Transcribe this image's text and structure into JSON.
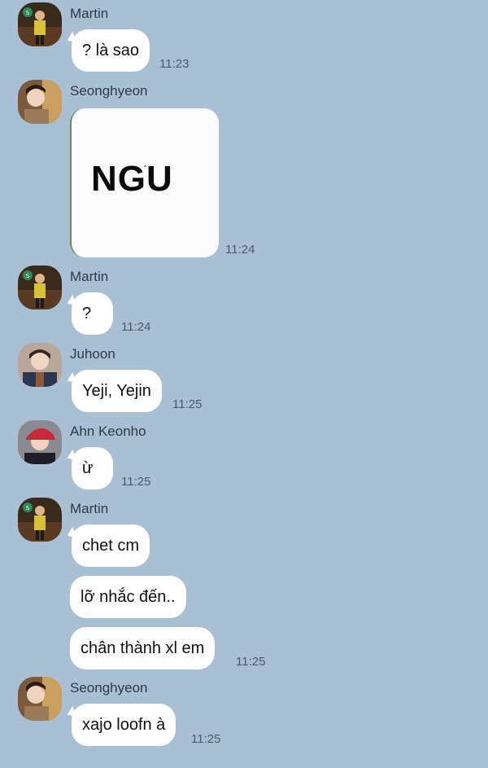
{
  "messages": [
    {
      "sender": "Martin",
      "text": "? là sao",
      "time": "11:23"
    },
    {
      "sender": "Seonghyeon",
      "sticker_text": "NGU",
      "sticker_accent": "ˆ",
      "time": "11:24"
    },
    {
      "sender": "Martin",
      "text": "?",
      "time": "11:24"
    },
    {
      "sender": "Juhoon",
      "text": "Yeji, Yejin",
      "time": "11:25"
    },
    {
      "sender": "Ahn Keonho",
      "text": "ừ",
      "time": "11:25"
    },
    {
      "sender": "Martin",
      "texts": [
        "chet cm",
        "lỡ nhắc đến..",
        "chân thành xl em"
      ],
      "time": "11:25"
    },
    {
      "sender": "Seonghyeon",
      "text": "xajo loofn à",
      "time": "11:25"
    }
  ],
  "colors": {
    "background": "#a9bfd4",
    "bubble": "#ffffff",
    "sender_text": "#2f3a45",
    "time_text": "#4b5a68"
  },
  "icons": {
    "martin": "avatar-martin-icon",
    "seonghyeon": "avatar-seonghyeon-icon",
    "juhoon": "avatar-juhoon-icon",
    "keonho": "avatar-keonho-icon"
  }
}
